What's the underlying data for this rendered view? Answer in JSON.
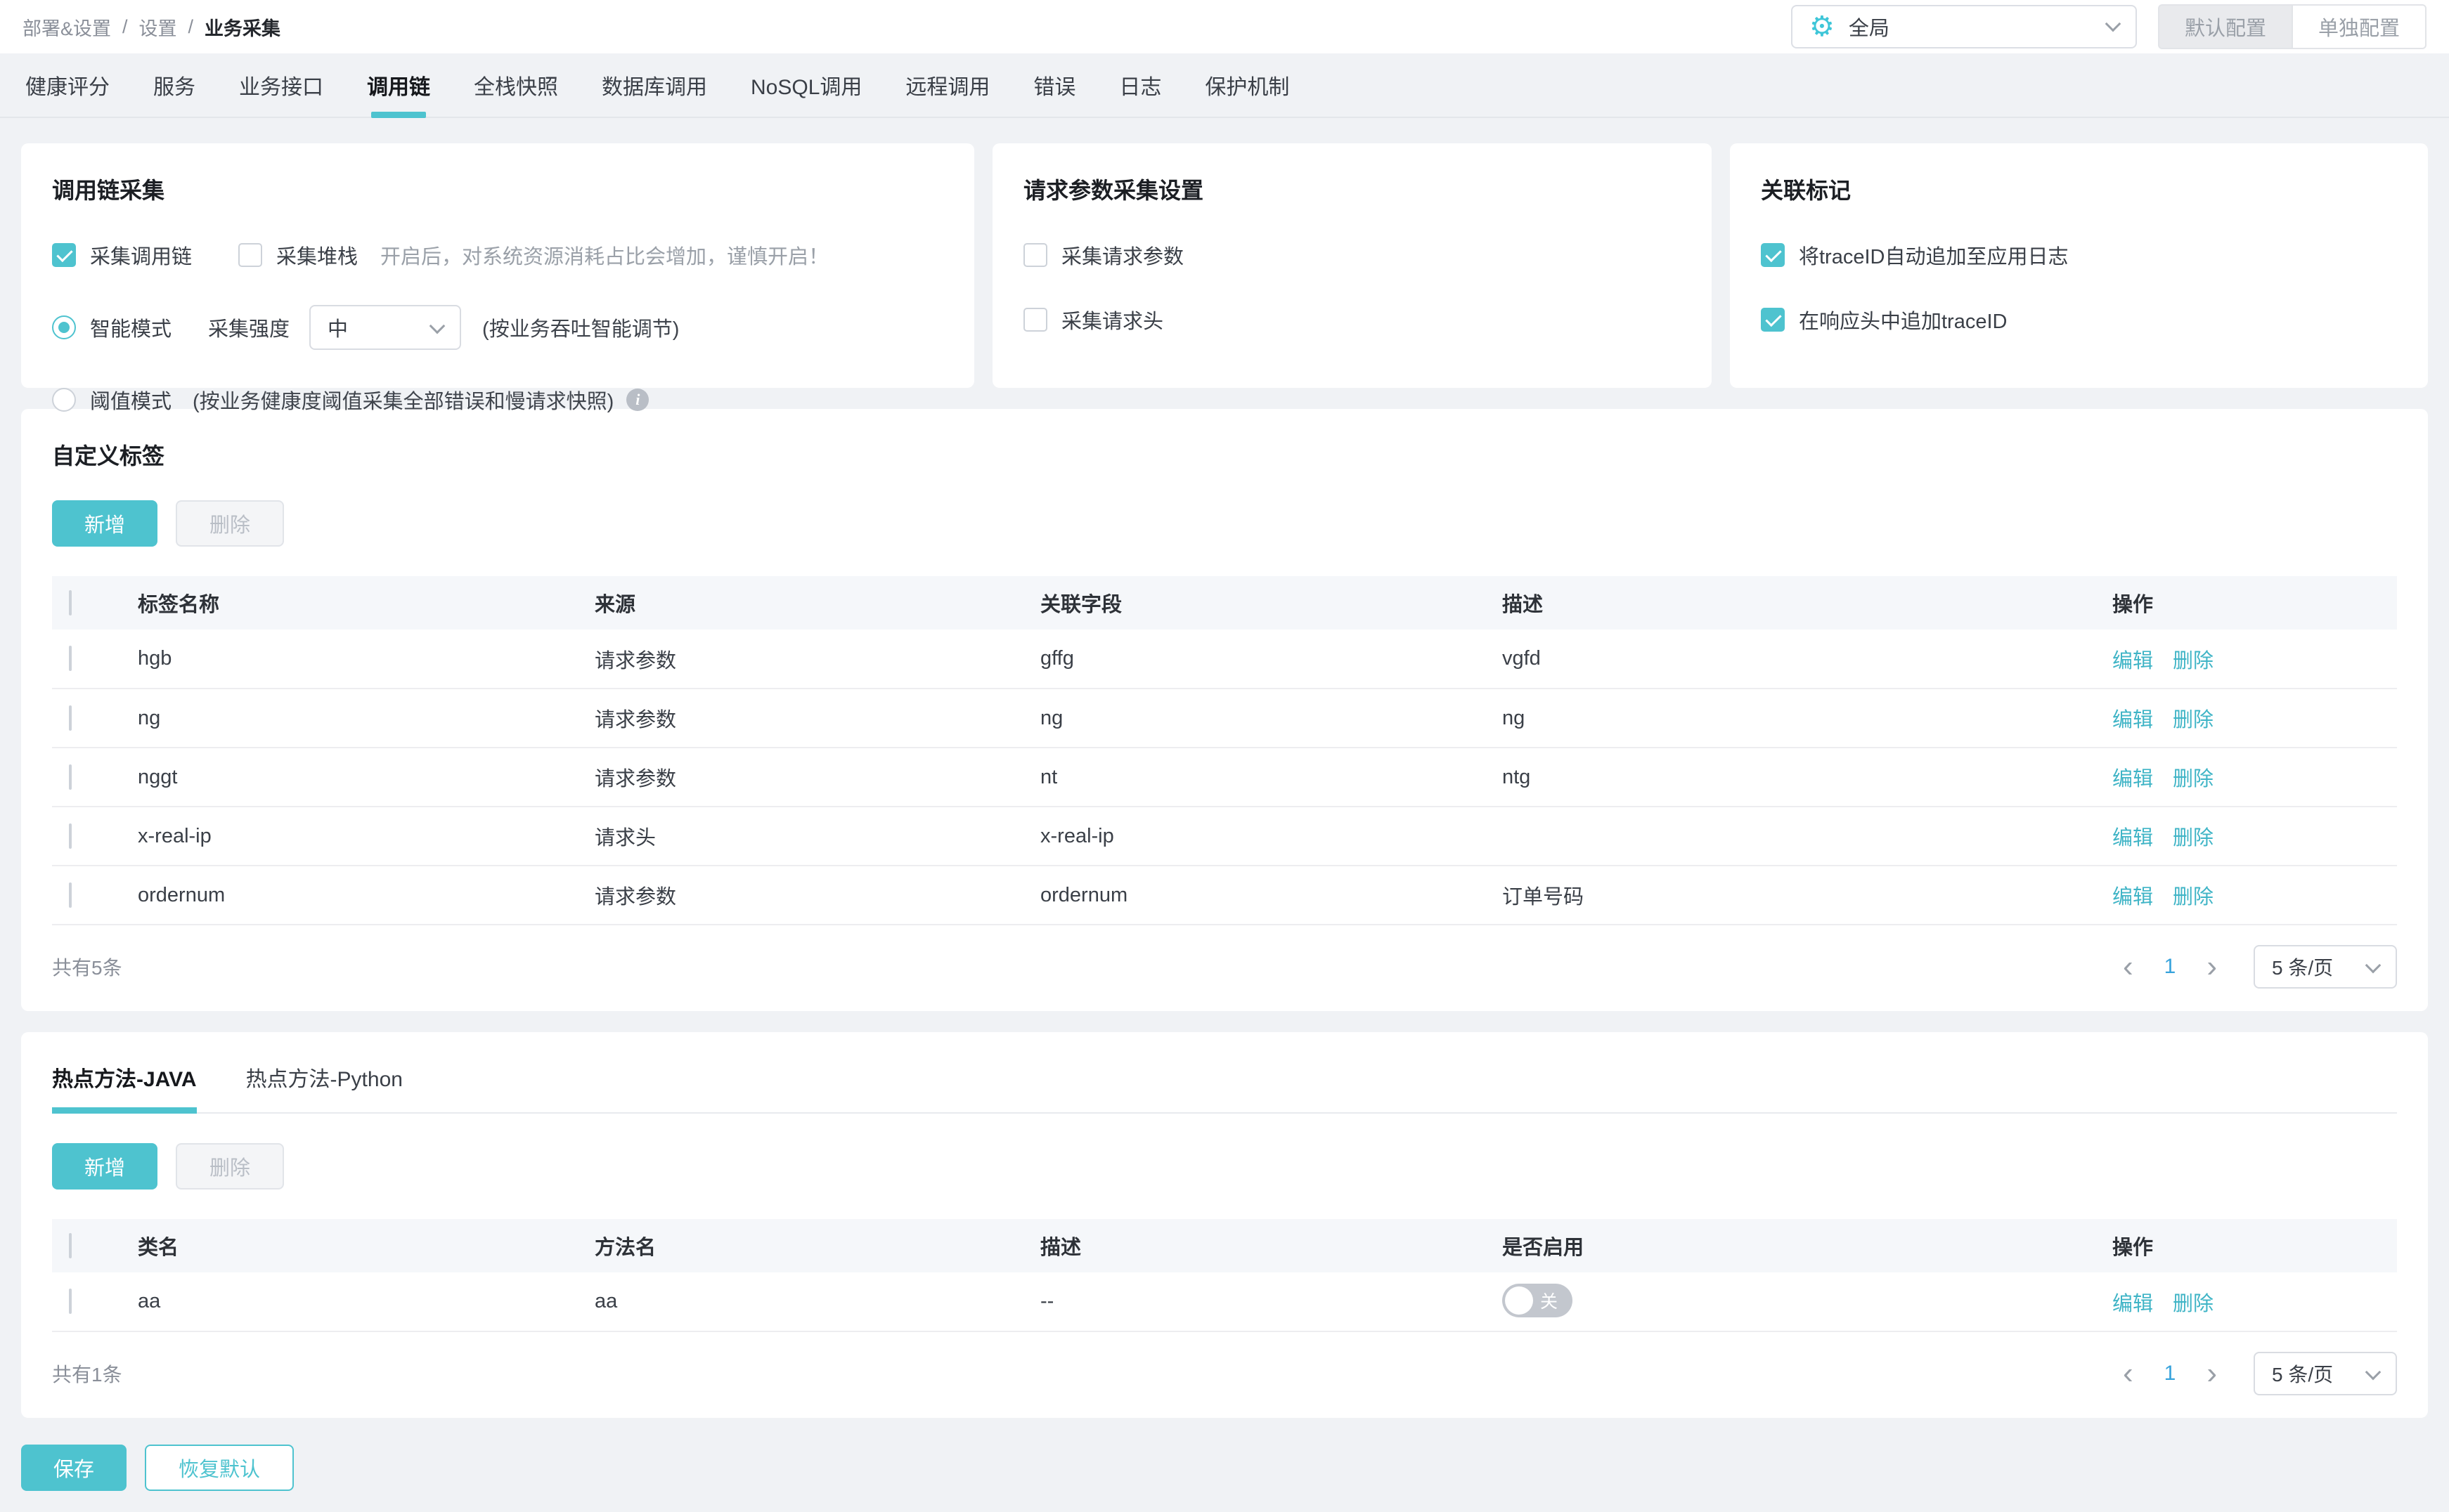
{
  "breadcrumb": {
    "items": [
      "部署&设置",
      "设置",
      "业务采集"
    ],
    "separator": "/"
  },
  "header": {
    "scope_value": "全局",
    "default_config_label": "默认配置",
    "separate_config_label": "单独配置"
  },
  "tabs": {
    "items": [
      {
        "label": "健康评分",
        "active": false
      },
      {
        "label": "服务",
        "active": false
      },
      {
        "label": "业务接口",
        "active": false
      },
      {
        "label": "调用链",
        "active": true
      },
      {
        "label": "全栈快照",
        "active": false
      },
      {
        "label": "数据库调用",
        "active": false
      },
      {
        "label": "NoSQL调用",
        "active": false
      },
      {
        "label": "远程调用",
        "active": false
      },
      {
        "label": "错误",
        "active": false
      },
      {
        "label": "日志",
        "active": false
      },
      {
        "label": "保护机制",
        "active": false
      }
    ]
  },
  "panels": {
    "trace": {
      "title": "调用链采集",
      "collect_trace": {
        "label": "采集调用链",
        "checked": true
      },
      "collect_stack": {
        "label": "采集堆栈",
        "checked": false
      },
      "stack_hint": "开启后，对系统资源消耗占比会增加，谨慎开启！",
      "smart_mode": {
        "label": "智能模式",
        "selected": true
      },
      "strength_label": "采集强度",
      "strength_value": "中",
      "smart_hint": "(按业务吞吐智能调节)",
      "threshold_mode": {
        "label": "阈值模式",
        "selected": false
      },
      "threshold_hint": "(按业务健康度阈值采集全部错误和慢请求快照)",
      "info_glyph": "i"
    },
    "request_params": {
      "title": "请求参数采集设置",
      "items": [
        {
          "label": "采集请求参数",
          "checked": false
        },
        {
          "label": "采集请求头",
          "checked": false
        }
      ]
    },
    "relation": {
      "title": "关联标记",
      "items": [
        {
          "label": "将traceID自动追加至应用日志",
          "checked": true
        },
        {
          "label": "在响应头中追加traceID",
          "checked": true
        }
      ]
    }
  },
  "custom_tags": {
    "title": "自定义标签",
    "add_label": "新增",
    "delete_label": "删除",
    "columns": [
      "标签名称",
      "来源",
      "关联字段",
      "描述",
      "操作"
    ],
    "rows": [
      {
        "name": "hgb",
        "source": "请求参数",
        "field": "gffg",
        "desc": "vgfd"
      },
      {
        "name": "ng",
        "source": "请求参数",
        "field": "ng",
        "desc": "ng"
      },
      {
        "name": "nggt",
        "source": "请求参数",
        "field": "nt",
        "desc": "ntg"
      },
      {
        "name": "x-real-ip",
        "source": "请求头",
        "field": "x-real-ip",
        "desc": ""
      },
      {
        "name": "ordernum",
        "source": "请求参数",
        "field": "ordernum",
        "desc": "订单号码"
      }
    ],
    "edit_label": "编辑",
    "delete_row_label": "删除",
    "total_text": "共有5条",
    "pagination": {
      "prev": "‹",
      "page": "1",
      "next": "›",
      "page_size": "5 条/页"
    }
  },
  "hot_methods": {
    "tabs": [
      {
        "label": "热点方法-JAVA",
        "active": true
      },
      {
        "label": "热点方法-Python",
        "active": false
      }
    ],
    "add_label": "新增",
    "delete_label": "删除",
    "columns": [
      "类名",
      "方法名",
      "描述",
      "是否启用",
      "操作"
    ],
    "rows": [
      {
        "class_name": "aa",
        "method": "aa",
        "desc": "--",
        "enabled": false,
        "toggle_label": "关"
      }
    ],
    "edit_label": "编辑",
    "delete_row_label": "删除",
    "total_text": "共有1条",
    "pagination": {
      "prev": "‹",
      "page": "1",
      "next": "›",
      "page_size": "5 条/页"
    }
  },
  "footer": {
    "save_label": "保存",
    "reset_label": "恢复默认"
  },
  "colors": {
    "accent": "#4EC3CF",
    "link": "#3FB4C6",
    "active_page": "#38A3DC",
    "page_bg": "#F0F2F5"
  }
}
